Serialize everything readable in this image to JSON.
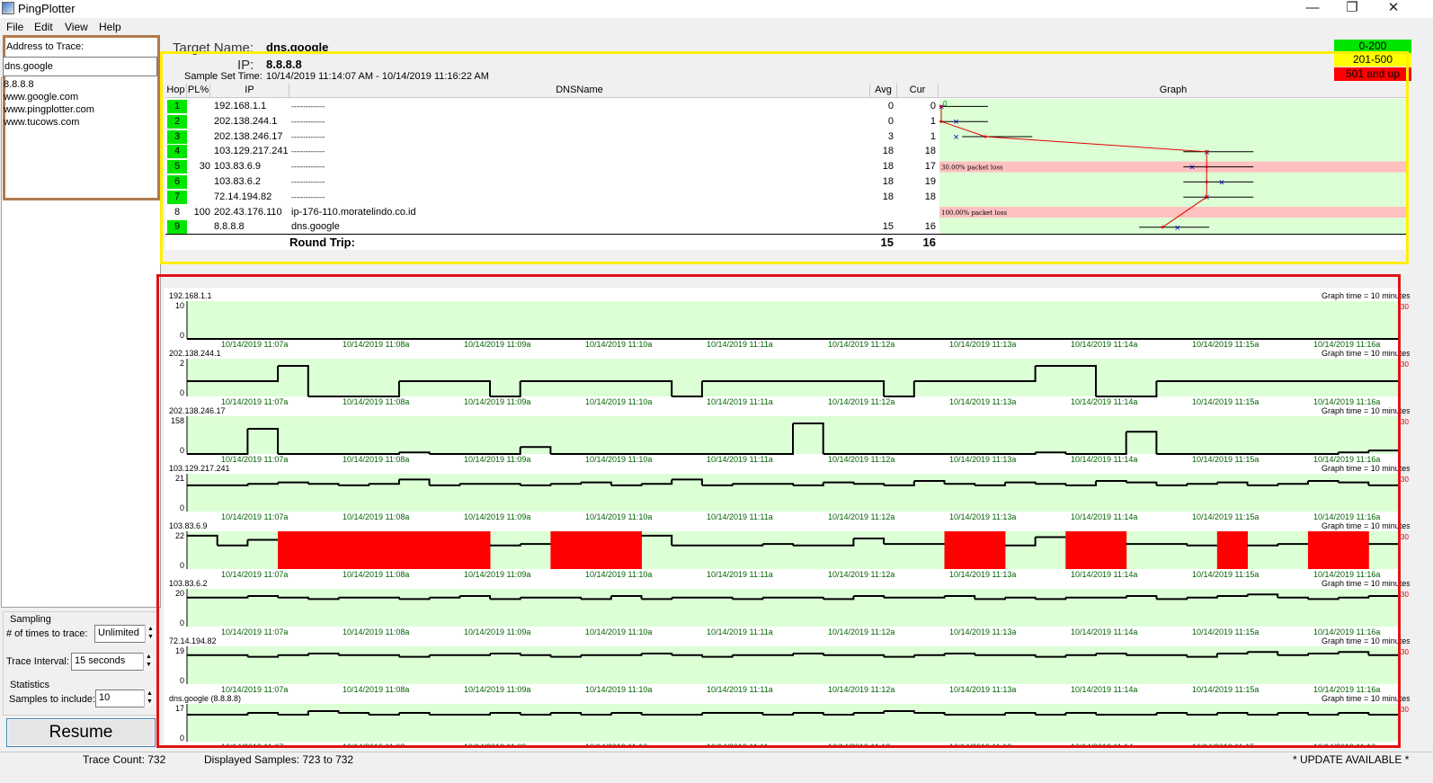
{
  "window": {
    "title": "PingPlotter",
    "minimize": "—",
    "restore": "❐",
    "close": "✕"
  },
  "menu": [
    "File",
    "Edit",
    "View",
    "Help"
  ],
  "sidebar": {
    "address_label": "Address to Trace:",
    "address_value": "dns.google",
    "recent": [
      "8.8.8.8",
      "www.google.com",
      "www.pingplotter.com",
      "www.tucows.com"
    ],
    "sampling_label": "Sampling",
    "times_label": "# of times to trace:",
    "times_value": "Unlimited",
    "interval_label": "Trace Interval:",
    "interval_value": "15 seconds",
    "statistics_label": "Statistics",
    "samples_label": "Samples to include:",
    "samples_value": "10",
    "resume_label": "Resume"
  },
  "header": {
    "target_label": "Target Name:",
    "target_value": "dns.google",
    "ip_label": "IP:",
    "ip_value": "8.8.8.8",
    "sample_set_label": "Sample Set Time:",
    "sample_set_value": "10/14/2019 11:14:07 AM - 10/14/2019 11:16:22 AM"
  },
  "legend": [
    {
      "label": "0-200",
      "color": "#00e600"
    },
    {
      "label": "201-500",
      "color": "#ffff00"
    },
    {
      "label": "501 and up",
      "color": "#ff0000"
    }
  ],
  "table": {
    "columns": [
      "Hop",
      "PL%",
      "IP",
      "DNSName",
      "Avg",
      "Cur",
      "Graph"
    ],
    "graph_axis_left": "0",
    "rows": [
      {
        "hop": "1",
        "pl": "",
        "ip": "192.168.1.1",
        "dns": "--------------",
        "avg": "0",
        "cur": "0",
        "ok": true,
        "avg_ms": 0,
        "cur_ms": 0
      },
      {
        "hop": "2",
        "pl": "",
        "ip": "202.138.244.1",
        "dns": "--------------",
        "avg": "0",
        "cur": "1",
        "ok": true,
        "avg_ms": 0,
        "cur_ms": 1
      },
      {
        "hop": "3",
        "pl": "",
        "ip": "202.138.246.17",
        "dns": "--------------",
        "avg": "3",
        "cur": "1",
        "ok": true,
        "avg_ms": 3,
        "cur_ms": 1
      },
      {
        "hop": "4",
        "pl": "",
        "ip": "103.129.217.241",
        "dns": "--------------",
        "avg": "18",
        "cur": "18",
        "ok": true,
        "avg_ms": 18,
        "cur_ms": 18
      },
      {
        "hop": "5",
        "pl": "30",
        "ip": "103.83.6.9",
        "dns": "--------------",
        "avg": "18",
        "cur": "17",
        "ok": true,
        "avg_ms": 18,
        "cur_ms": 17,
        "loss_text": "30.00% packet loss"
      },
      {
        "hop": "6",
        "pl": "",
        "ip": "103.83.6.2",
        "dns": "--------------",
        "avg": "18",
        "cur": "19",
        "ok": true,
        "avg_ms": 18,
        "cur_ms": 19
      },
      {
        "hop": "7",
        "pl": "",
        "ip": "72.14.194.82",
        "dns": "--------------",
        "avg": "18",
        "cur": "18",
        "ok": true,
        "avg_ms": 18,
        "cur_ms": 18
      },
      {
        "hop": "8",
        "pl": "100",
        "ip": "202.43.176.110",
        "dns": "ip-176-110.moratelindo.co.id",
        "avg": "",
        "cur": "",
        "ok": false,
        "loss_text": "100.00% packet loss"
      },
      {
        "hop": "9",
        "pl": "",
        "ip": "8.8.8.8",
        "dns": "dns.google",
        "avg": "15",
        "cur": "16",
        "ok": true,
        "avg_ms": 15,
        "cur_ms": 16
      }
    ],
    "round_trip_label": "Round Trip:",
    "round_trip_avg": "15",
    "round_trip_cur": "16"
  },
  "timeline": {
    "graph_time_label": "Graph time = 10 minutes",
    "right_marker": "30",
    "time_labels": [
      "10/14/2019 11:07a",
      "10/14/2019 11:08a",
      "10/14/2019 11:09a",
      "10/14/2019 11:10a",
      "10/14/2019 11:11a",
      "10/14/2019 11:12a",
      "10/14/2019 11:13a",
      "10/14/2019 11:14a",
      "10/14/2019 11:15a",
      "10/14/2019 11:16a"
    ],
    "charts": [
      {
        "host": "192.168.1.1",
        "ymax": "10",
        "ymin": "0",
        "values": [
          0,
          0,
          0,
          0,
          0,
          0,
          0,
          0,
          0,
          0,
          0,
          0,
          0,
          0,
          0,
          0,
          0,
          0,
          0,
          0,
          0,
          0,
          0,
          0,
          0,
          0,
          0,
          0,
          0,
          0,
          0,
          0,
          0,
          0,
          0,
          0,
          0,
          0,
          0,
          0
        ],
        "loss": []
      },
      {
        "host": "202.138.244.1",
        "ymax": "2",
        "ymin": "0",
        "values": [
          1,
          1,
          1,
          2,
          0,
          0,
          0,
          1,
          1,
          1,
          0,
          1,
          1,
          1,
          1,
          1,
          0,
          1,
          1,
          1,
          1,
          1,
          1,
          0,
          1,
          1,
          1,
          1,
          2,
          2,
          0,
          0,
          1,
          1,
          1,
          1,
          1,
          1,
          1,
          1
        ],
        "loss": []
      },
      {
        "host": "202.138.246.17",
        "ymax": "158",
        "ymin": "0",
        "values": [
          0,
          0,
          130,
          0,
          0,
          0,
          0,
          8,
          0,
          0,
          0,
          36,
          0,
          0,
          0,
          0,
          0,
          0,
          0,
          0,
          158,
          0,
          0,
          0,
          0,
          0,
          0,
          0,
          8,
          0,
          0,
          115,
          0,
          0,
          0,
          0,
          0,
          0,
          8,
          18
        ],
        "loss": []
      },
      {
        "host": "103.129.217.241",
        "ymax": "21",
        "ymin": "0",
        "values": [
          18,
          18,
          19,
          20,
          19,
          18,
          19,
          22,
          18,
          19,
          19,
          18,
          19,
          20,
          18,
          19,
          22,
          18,
          19,
          19,
          18,
          20,
          19,
          18,
          21,
          19,
          18,
          20,
          19,
          18,
          21,
          20,
          18,
          19,
          20,
          18,
          19,
          21,
          20,
          18
        ],
        "loss": []
      },
      {
        "host": "103.83.6.9",
        "ymax": "22",
        "ymin": "0",
        "values": [
          24,
          17,
          21,
          0,
          0,
          0,
          0,
          0,
          0,
          0,
          17,
          18,
          0,
          0,
          0,
          24,
          17,
          17,
          17,
          18,
          17,
          17,
          22,
          18,
          18,
          0,
          0,
          17,
          23,
          0,
          0,
          18,
          18,
          17,
          0,
          17,
          18,
          0,
          18,
          18
        ],
        "loss": [
          3,
          4,
          5,
          6,
          7,
          8,
          9,
          12,
          13,
          14,
          25,
          26,
          29,
          30,
          34,
          37,
          38
        ]
      },
      {
        "host": "103.83.6.2",
        "ymax": "20",
        "ymin": "0",
        "values": [
          19,
          19,
          20,
          19,
          18,
          19,
          19,
          18,
          19,
          20,
          18,
          19,
          19,
          18,
          20,
          18,
          19,
          19,
          18,
          19,
          19,
          18,
          20,
          19,
          19,
          20,
          18,
          19,
          18,
          19,
          19,
          20,
          18,
          19,
          20,
          21,
          19,
          18,
          19,
          20
        ],
        "loss": []
      },
      {
        "host": "72.14.194.82",
        "ymax": "19",
        "ymin": "0",
        "values": [
          18,
          18,
          17,
          18,
          19,
          18,
          18,
          17,
          18,
          18,
          19,
          18,
          17,
          18,
          18,
          19,
          18,
          17,
          18,
          18,
          19,
          18,
          18,
          17,
          18,
          19,
          18,
          18,
          17,
          18,
          19,
          18,
          18,
          17,
          19,
          20,
          18,
          19,
          20,
          18
        ],
        "loss": []
      },
      {
        "host": "dns.google (8.8.8.8)",
        "ymax": "17",
        "ymin": "0",
        "values": [
          15,
          15,
          16,
          15,
          17,
          16,
          15,
          16,
          15,
          15,
          16,
          15,
          16,
          15,
          16,
          15,
          15,
          16,
          16,
          15,
          16,
          15,
          16,
          17,
          16,
          15,
          15,
          16,
          15,
          16,
          15,
          15,
          16,
          15,
          16,
          15,
          16,
          15,
          16,
          15
        ],
        "loss": []
      }
    ]
  },
  "status": {
    "trace_count": "Trace Count: 732",
    "displayed_samples": "Displayed Samples: 723 to 732",
    "update": "* UPDATE AVAILABLE *"
  }
}
